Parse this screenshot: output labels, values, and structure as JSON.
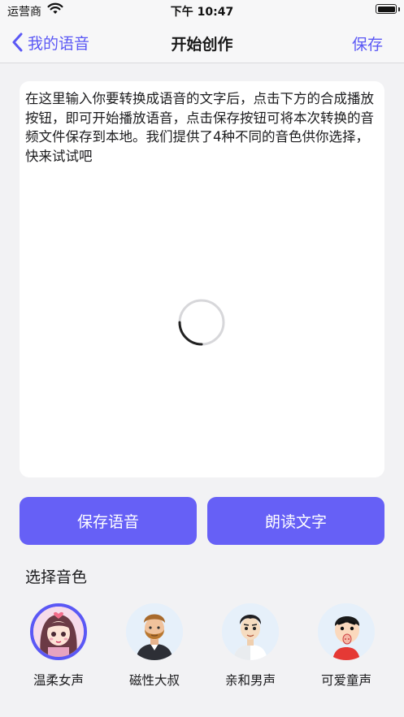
{
  "status": {
    "carrier": "运营商",
    "time": "下午 10:47"
  },
  "nav": {
    "back_label": "我的语音",
    "title": "开始创作",
    "save_label": "保存"
  },
  "editor": {
    "text": "在这里输入你要转换成语音的文字后，点击下方的合成播放按钮，即可开始播放语音，点击保存按钮可将本次转换的音频文件保存到本地。我们提供了4种不同的音色供你选择，快来试试吧"
  },
  "actions": {
    "save_voice": "保存语音",
    "read_text": "朗读文字"
  },
  "voices": {
    "heading": "选择音色",
    "items": [
      {
        "label": "温柔女声",
        "selected": true
      },
      {
        "label": "磁性大叔",
        "selected": false
      },
      {
        "label": "亲和男声",
        "selected": false
      },
      {
        "label": "可爱童声",
        "selected": false
      }
    ]
  },
  "colors": {
    "accent": "#6660f6",
    "link": "#5b58f5",
    "background": "#f2f2f4"
  }
}
